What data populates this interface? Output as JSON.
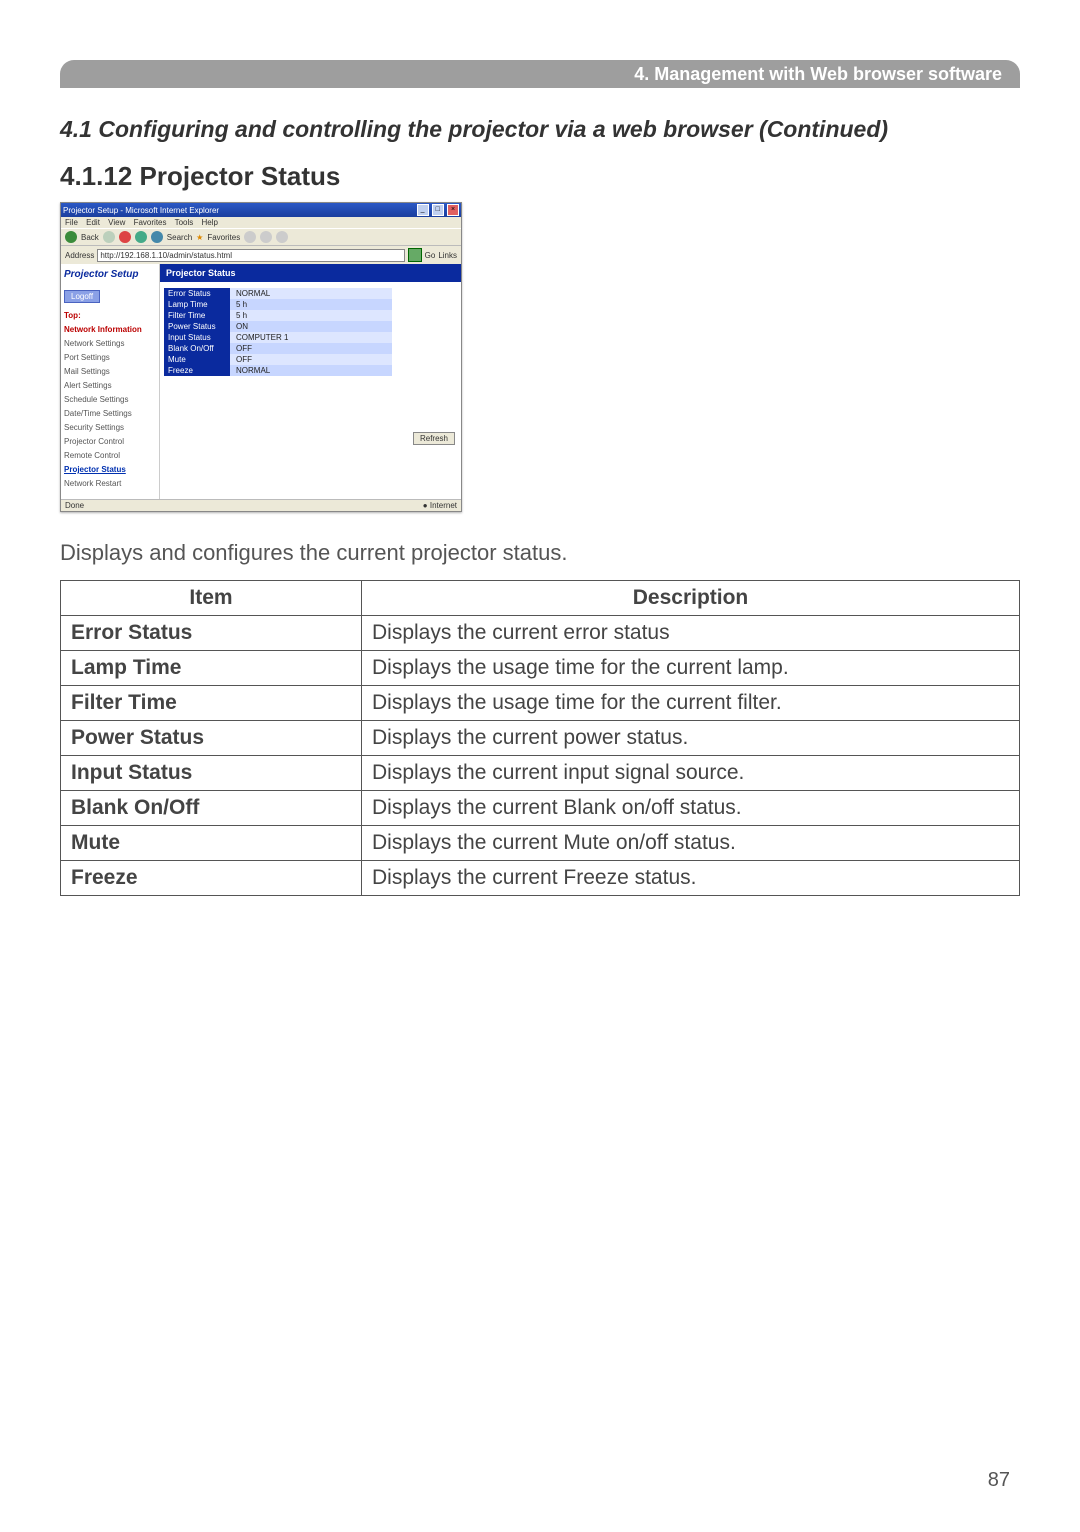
{
  "chapter_bar": "4. Management with Web browser software",
  "section_title": "4.1 Configuring and controlling the projector via a web browser (Continued)",
  "subsection_title": "4.1.12 Projector Status",
  "lead_text": "Displays and configures the current projector status.",
  "page_number": "87",
  "shot": {
    "window_title": "Projector Setup - Microsoft Internet Explorer",
    "menubar": [
      "File",
      "Edit",
      "View",
      "Favorites",
      "Tools",
      "Help"
    ],
    "toolbar": {
      "back": "Back",
      "search": "Search",
      "favorites": "Favorites"
    },
    "address_label": "Address",
    "address_value": "http://192.168.1.10/admin/status.html",
    "go_label": "Go",
    "links_label": "Links",
    "sidebar_brand": "Projector Setup",
    "logoff": "Logoff",
    "nav": {
      "top": "Top:",
      "group": "Network Information",
      "items": [
        "Network Settings",
        "Port Settings",
        "Mail Settings",
        "Alert Settings",
        "Schedule Settings",
        "Date/Time Settings",
        "Security Settings",
        "Projector Control",
        "Remote Control"
      ],
      "current": "Projector Status",
      "after": "Network Restart"
    },
    "panel_title": "Projector Status",
    "rows": [
      {
        "k": "Error Status",
        "v": "NORMAL"
      },
      {
        "k": "Lamp Time",
        "v": "5 h"
      },
      {
        "k": "Filter Time",
        "v": "5 h"
      },
      {
        "k": "Power Status",
        "v": "ON"
      },
      {
        "k": "Input Status",
        "v": "COMPUTER 1"
      },
      {
        "k": "Blank On/Off",
        "v": "OFF"
      },
      {
        "k": "Mute",
        "v": "OFF"
      },
      {
        "k": "Freeze",
        "v": "NORMAL"
      }
    ],
    "refresh": "Refresh",
    "status_left": "Done",
    "status_right": "Internet"
  },
  "table": {
    "head_item": "Item",
    "head_desc": "Description",
    "rows": [
      {
        "item": "Error Status",
        "desc": "Displays the current error status"
      },
      {
        "item": "Lamp Time",
        "desc": "Displays the usage time for the current lamp."
      },
      {
        "item": "Filter Time",
        "desc": "Displays the usage time for the current filter."
      },
      {
        "item": "Power Status",
        "desc": "Displays the current power status."
      },
      {
        "item": "Input Status",
        "desc": "Displays the current input signal source."
      },
      {
        "item": "Blank On/Off",
        "desc": "Displays the current Blank on/off status."
      },
      {
        "item": "Mute",
        "desc": "Displays the current Mute on/off status."
      },
      {
        "item": "Freeze",
        "desc": "Displays the current Freeze status."
      }
    ]
  }
}
